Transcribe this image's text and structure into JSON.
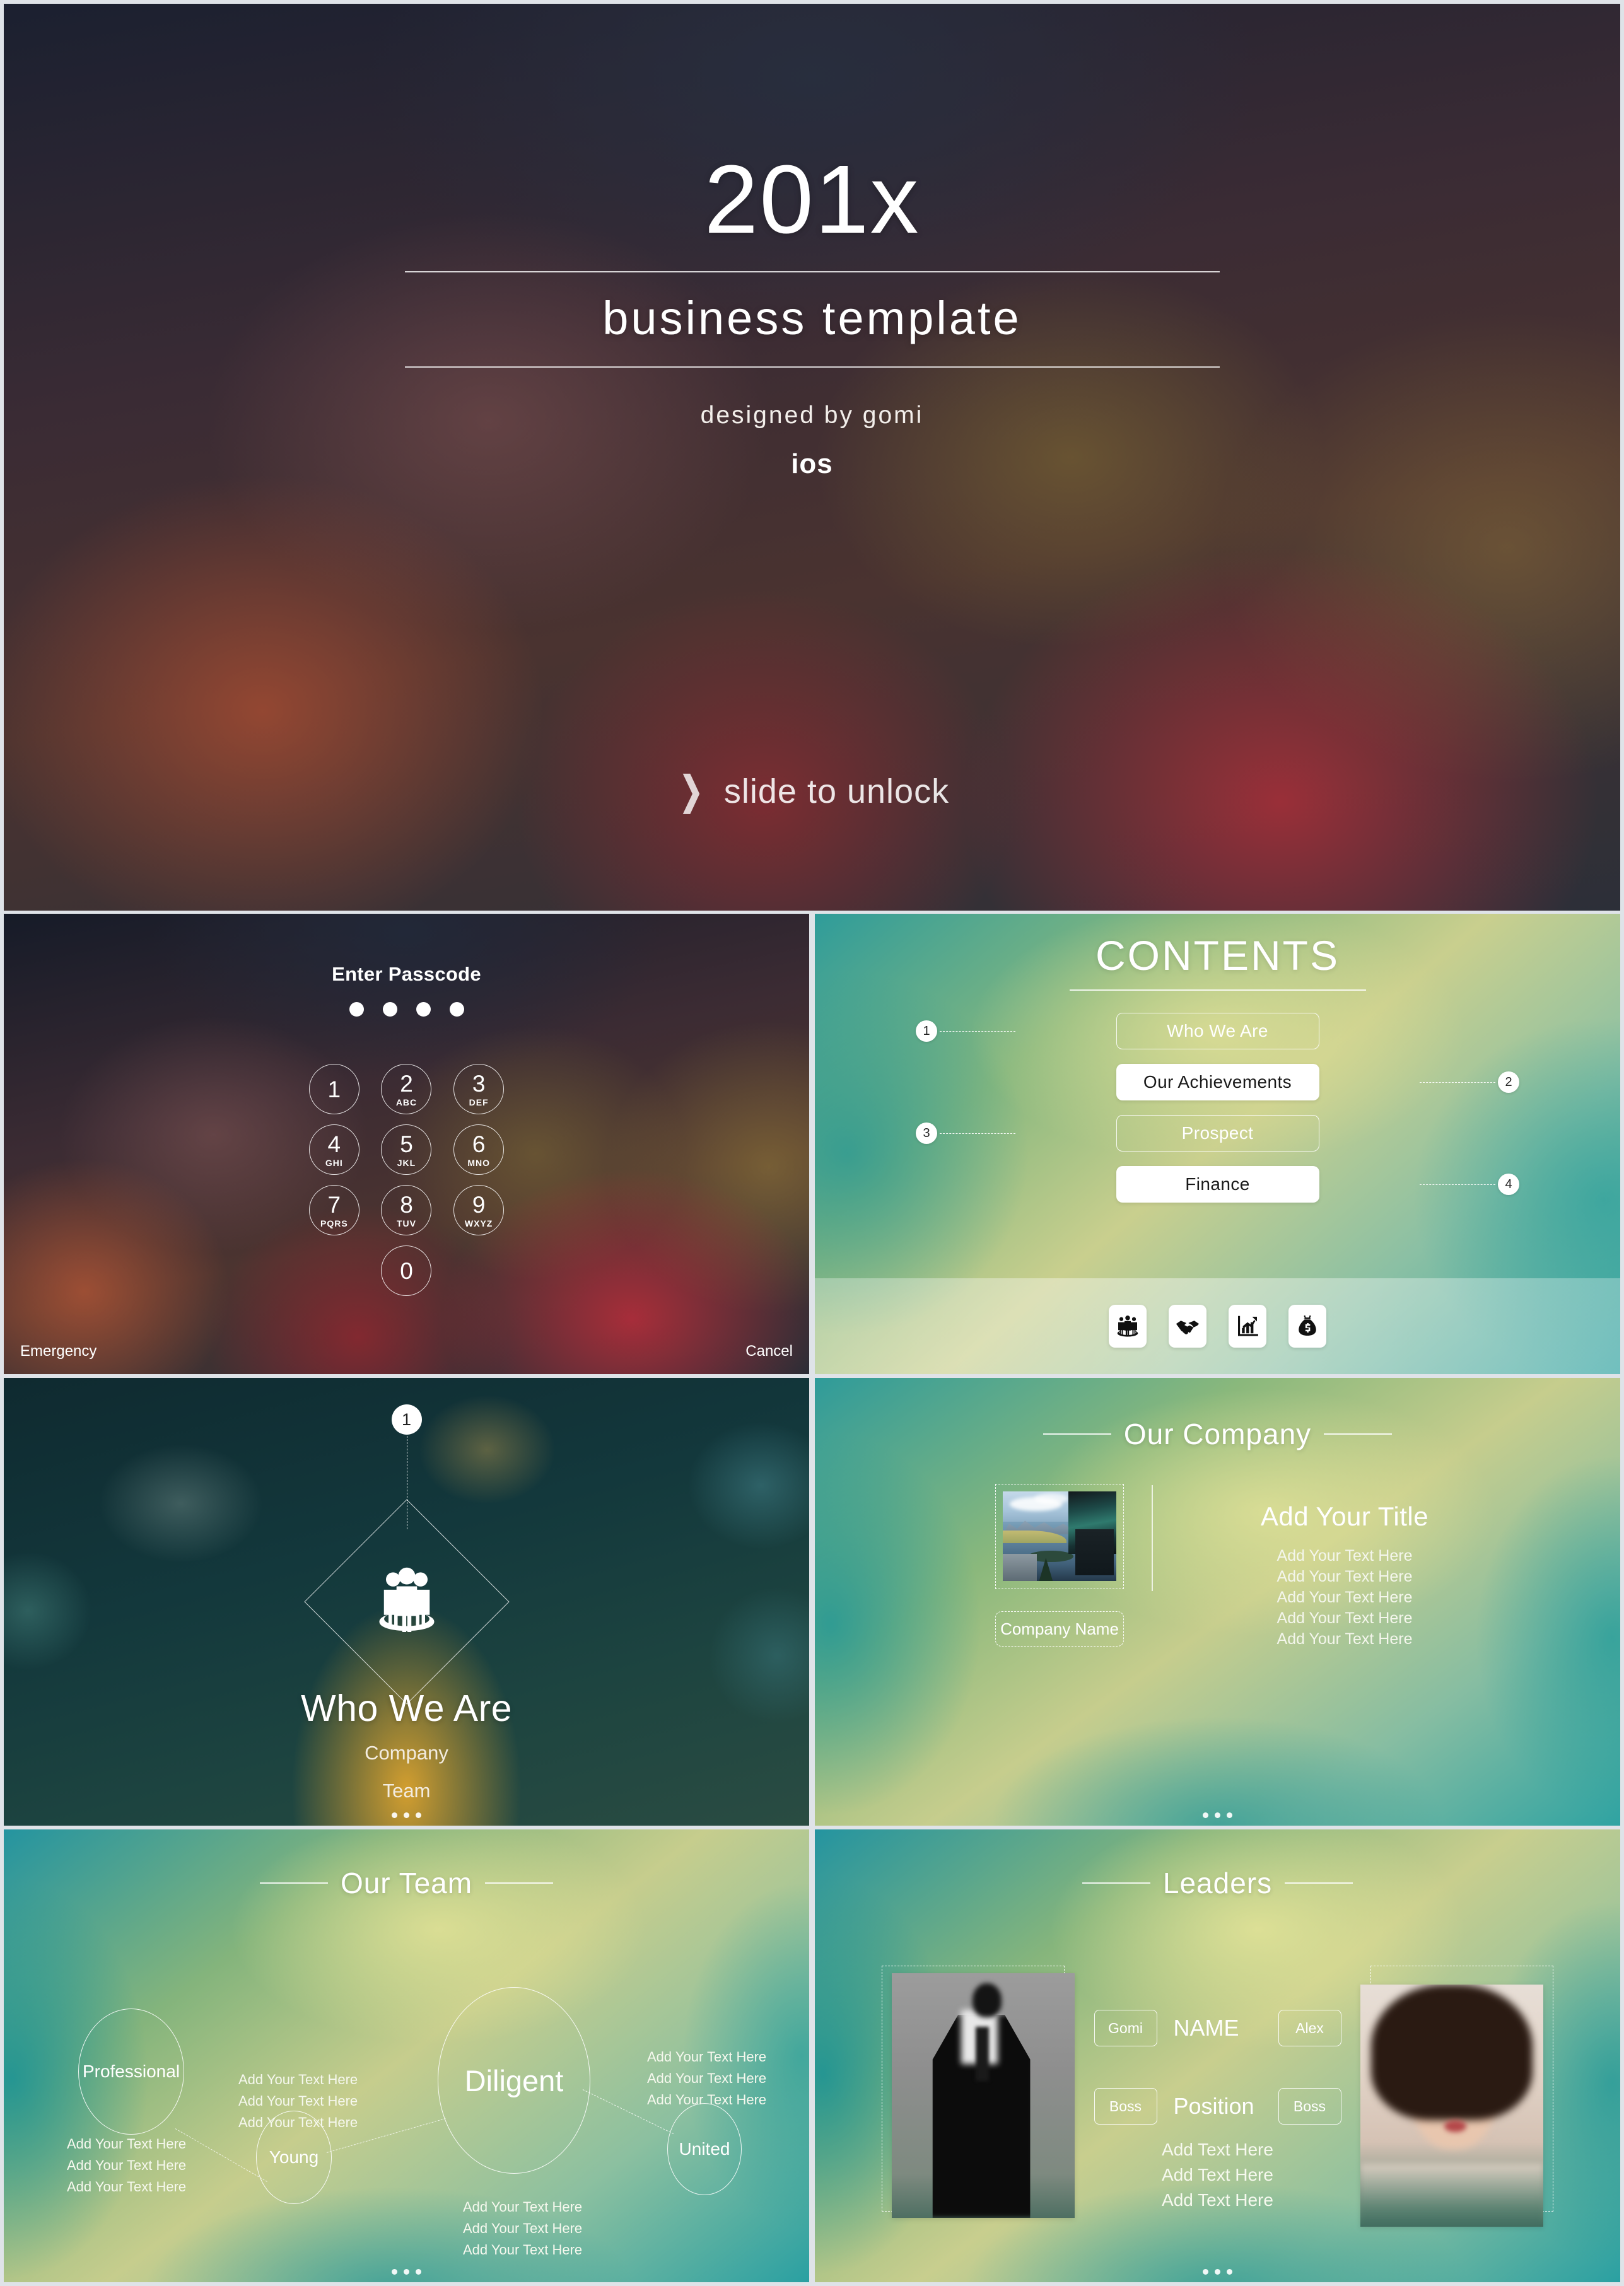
{
  "title_slide": {
    "year": "201x",
    "subtitle": "business  template",
    "designed_by": "designed  by  gomi",
    "os": "ios",
    "unlock_chevron": "❯",
    "unlock_text": "slide to unlock"
  },
  "passcode_slide": {
    "heading": "Enter Passcode",
    "dot_count": 4,
    "keys": [
      {
        "num": "1",
        "alpha": ""
      },
      {
        "num": "2",
        "alpha": "ABC"
      },
      {
        "num": "3",
        "alpha": "DEF"
      },
      {
        "num": "4",
        "alpha": "GHI"
      },
      {
        "num": "5",
        "alpha": "JKL"
      },
      {
        "num": "6",
        "alpha": "MNO"
      },
      {
        "num": "7",
        "alpha": "PQRS"
      },
      {
        "num": "8",
        "alpha": "TUV"
      },
      {
        "num": "9",
        "alpha": "WXYZ"
      },
      {
        "num": "0",
        "alpha": ""
      }
    ],
    "emergency_label": "Emergency",
    "cancel_label": "Cancel"
  },
  "contents_slide": {
    "title": "CONTENTS",
    "items": [
      {
        "number": "1",
        "label": "Who We Are",
        "style": "outline",
        "badge_side": "left"
      },
      {
        "number": "2",
        "label": "Our Achievements",
        "style": "filled",
        "badge_side": "right"
      },
      {
        "number": "3",
        "label": "Prospect",
        "style": "outline",
        "badge_side": "left"
      },
      {
        "number": "4",
        "label": "Finance",
        "style": "filled",
        "badge_side": "right"
      }
    ],
    "icons": [
      "people-group-icon",
      "handshake-icon",
      "bar-chart-growth-icon",
      "money-bag-icon"
    ]
  },
  "whoweare_slide": {
    "badge_number": "1",
    "icon": "people-group-icon",
    "heading": "Who We Are",
    "sub1": "Company",
    "sub2": "Team"
  },
  "company_slide": {
    "section_title": "Our Company",
    "photo_alt": "mountain-lake-building-photo",
    "company_name_placeholder": "Company Name",
    "body_title": "Add Your Title",
    "body_lines": [
      "Add Your Text Here",
      "Add Your Text Here",
      "Add Your Text Here",
      "Add Your Text Here",
      "Add Your Text Here"
    ]
  },
  "team_slide": {
    "section_title": "Our Team",
    "nodes": [
      {
        "label": "Professional"
      },
      {
        "label": "Young"
      },
      {
        "label": "Diligent"
      },
      {
        "label": "United"
      }
    ],
    "text_blocks": [
      [
        "Add Your Text Here",
        "Add Your Text Here",
        "Add Your Text Here"
      ],
      [
        "Add Your Text Here",
        "Add Your Text Here",
        "Add Your Text Here"
      ],
      [
        "Add Your Text Here",
        "Add Your Text Here",
        "Add Your Text Here"
      ],
      [
        "Add Your Text Here",
        "Add Your Text Here",
        "Add Your Text Here"
      ]
    ]
  },
  "leaders_slide": {
    "section_title": "Leaders",
    "left_photo_alt": "man-in-suit-photo",
    "right_photo_alt": "woman-portrait-photo",
    "name_row": {
      "left_pill": "Gomi",
      "label": "NAME",
      "right_pill": "Alex"
    },
    "position_row": {
      "left_pill": "Boss",
      "label": "Position",
      "right_pill": "Boss"
    },
    "body_lines": [
      "Add Text Here",
      "Add Text Here",
      "Add Text Here"
    ]
  },
  "colors": {
    "accent_white": "#ffffff",
    "teal": "#2f9b9a",
    "olive": "#c6cd8d",
    "dark_navy": "#1b2030",
    "gold": "#e2a62e"
  }
}
